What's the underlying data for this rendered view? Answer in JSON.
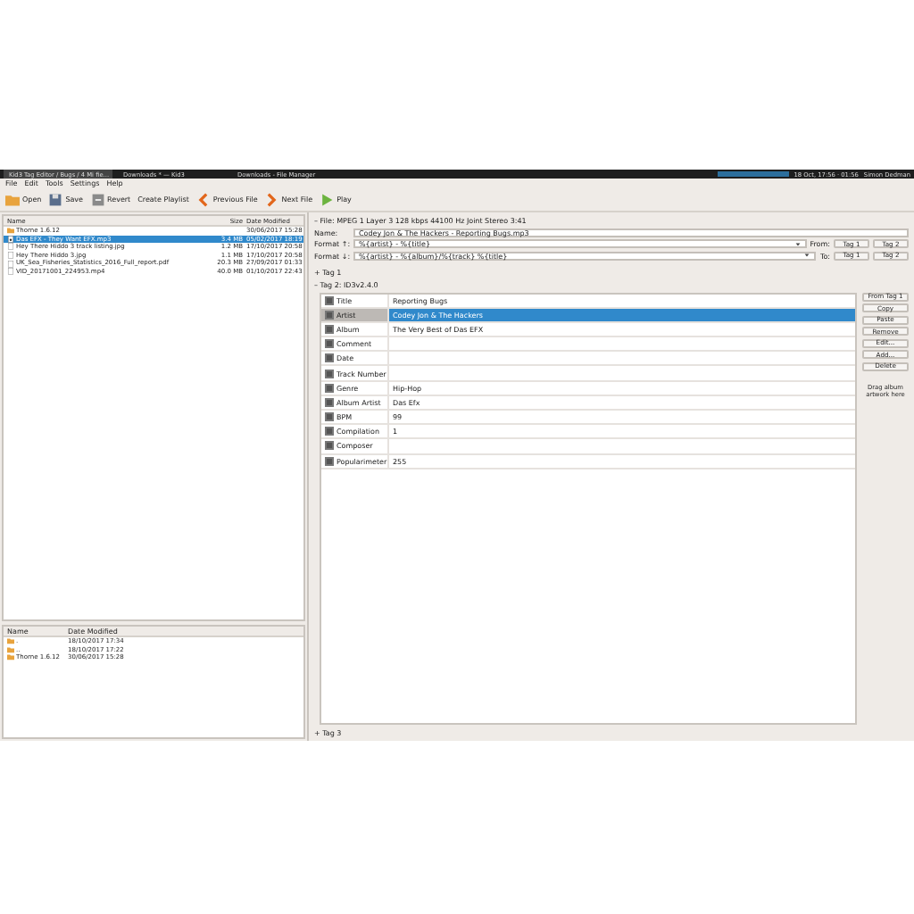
{
  "panel": {
    "windows": [
      {
        "title": "Kid3 Tag Editor / Bugs / 4 Mi fie...",
        "selected": true
      },
      {
        "title": "Downloads * — Kid3",
        "selected": false
      },
      {
        "title": "Downloads - File Manager",
        "selected": false
      }
    ],
    "clock": "18 Oct, 17:56 · 01:56",
    "user": "Simon Dedman"
  },
  "menu": [
    "File",
    "Edit",
    "Tools",
    "Settings",
    "Help"
  ],
  "toolbar": [
    {
      "label": "Open",
      "kind": "open"
    },
    {
      "label": "Save",
      "kind": "save"
    },
    {
      "label": "Revert",
      "kind": "revert"
    },
    {
      "label": "Create Playlist",
      "kind": "none"
    },
    {
      "label": "Previous File",
      "kind": "prev"
    },
    {
      "label": "Next File",
      "kind": "next"
    },
    {
      "label": "Play",
      "kind": "play"
    }
  ],
  "file_list": {
    "columns": [
      "Name",
      "Size",
      "Date Modified"
    ],
    "rows": [
      {
        "kind": "folder",
        "name": "Thorne 1.6.12",
        "size": "",
        "date": "30/06/2017 15:28",
        "selected": false
      },
      {
        "kind": "audio",
        "name": "Das EFX - They Want EFX.mp3",
        "size": "3.4 MB",
        "date": "05/02/2017 18:19",
        "selected": true
      },
      {
        "kind": "file",
        "name": "Hey There Hiddo 3 track listing.jpg",
        "size": "1.2 MB",
        "date": "17/10/2017 20:58",
        "selected": false
      },
      {
        "kind": "file",
        "name": "Hey There Hiddo 3.jpg",
        "size": "1.1 MB",
        "date": "17/10/2017 20:58",
        "selected": false
      },
      {
        "kind": "file",
        "name": "UK_Sea_Fisheries_Statistics_2016_Full_report.pdf",
        "size": "20.3 MB",
        "date": "27/09/2017 01:33",
        "selected": false
      },
      {
        "kind": "file",
        "name": "VID_20171001_224953.mp4",
        "size": "40.0 MB",
        "date": "01/10/2017 22:43",
        "selected": false
      }
    ]
  },
  "dir_list": {
    "columns": [
      "Name",
      "Date Modified"
    ],
    "rows": [
      {
        "name": ".",
        "date": "18/10/2017 17:34"
      },
      {
        "name": "..",
        "date": "18/10/2017 17:22"
      },
      {
        "name": "Thorne 1.6.12",
        "date": "30/06/2017 15:28"
      }
    ]
  },
  "file_section": {
    "toggle": "–",
    "title": "File: MPEG 1 Layer 3 128 kbps 44100 Hz Joint Stereo 3:41",
    "name_label": "Name:",
    "name": "Codey Jon & The Hackers - Reporting Bugs.mp3",
    "formats": [
      {
        "label": "Format ↑:",
        "value": "%{artist} - %{title}",
        "dir": "From:",
        "buttons": [
          "Tag 1",
          "Tag 2"
        ]
      },
      {
        "label": "Format ↓:",
        "value": "%{artist} - %{album}/%{track} %{title}",
        "dir": "To:",
        "buttons": [
          "Tag 1",
          "Tag 2"
        ]
      }
    ]
  },
  "tag1": {
    "toggle": "+",
    "title": "Tag 1"
  },
  "tag2": {
    "toggle": "–",
    "title": "Tag 2: ID3v2.4.0",
    "frames": [
      {
        "name": "Title",
        "value": "Reporting Bugs",
        "checked": true,
        "selected": false
      },
      {
        "name": "Artist",
        "value": "Codey Jon & The Hackers",
        "checked": true,
        "selected": true
      },
      {
        "name": "Album",
        "value": "The Very Best of Das EFX",
        "checked": true,
        "selected": false
      },
      {
        "name": "Comment",
        "checked": true,
        "selected": false
      },
      {
        "name": "Date",
        "checked": true,
        "selected": false
      },
      {
        "name": "Track Number",
        "checked": true,
        "selected": false
      },
      {
        "name": "Genre",
        "value": "Hip-Hop",
        "checked": true,
        "selected": false
      },
      {
        "name": "Album Artist",
        "value": "Das Efx",
        "checked": true,
        "selected": false
      },
      {
        "name": "BPM",
        "value": "99",
        "checked": true,
        "selected": false
      },
      {
        "name": "Compilation",
        "value": "1",
        "checked": true,
        "selected": false
      },
      {
        "name": "Composer",
        "checked": true,
        "selected": false
      },
      {
        "name": "Popularimeter",
        "value": "255",
        "checked": true,
        "selected": false
      }
    ],
    "buttons": [
      "From Tag 1",
      "Copy",
      "Paste",
      "Remove",
      "Edit...",
      "Add...",
      "Delete"
    ],
    "artwork_hint": "Drag album artwork here"
  },
  "tag3": {
    "toggle": "+",
    "title": "Tag 3"
  }
}
